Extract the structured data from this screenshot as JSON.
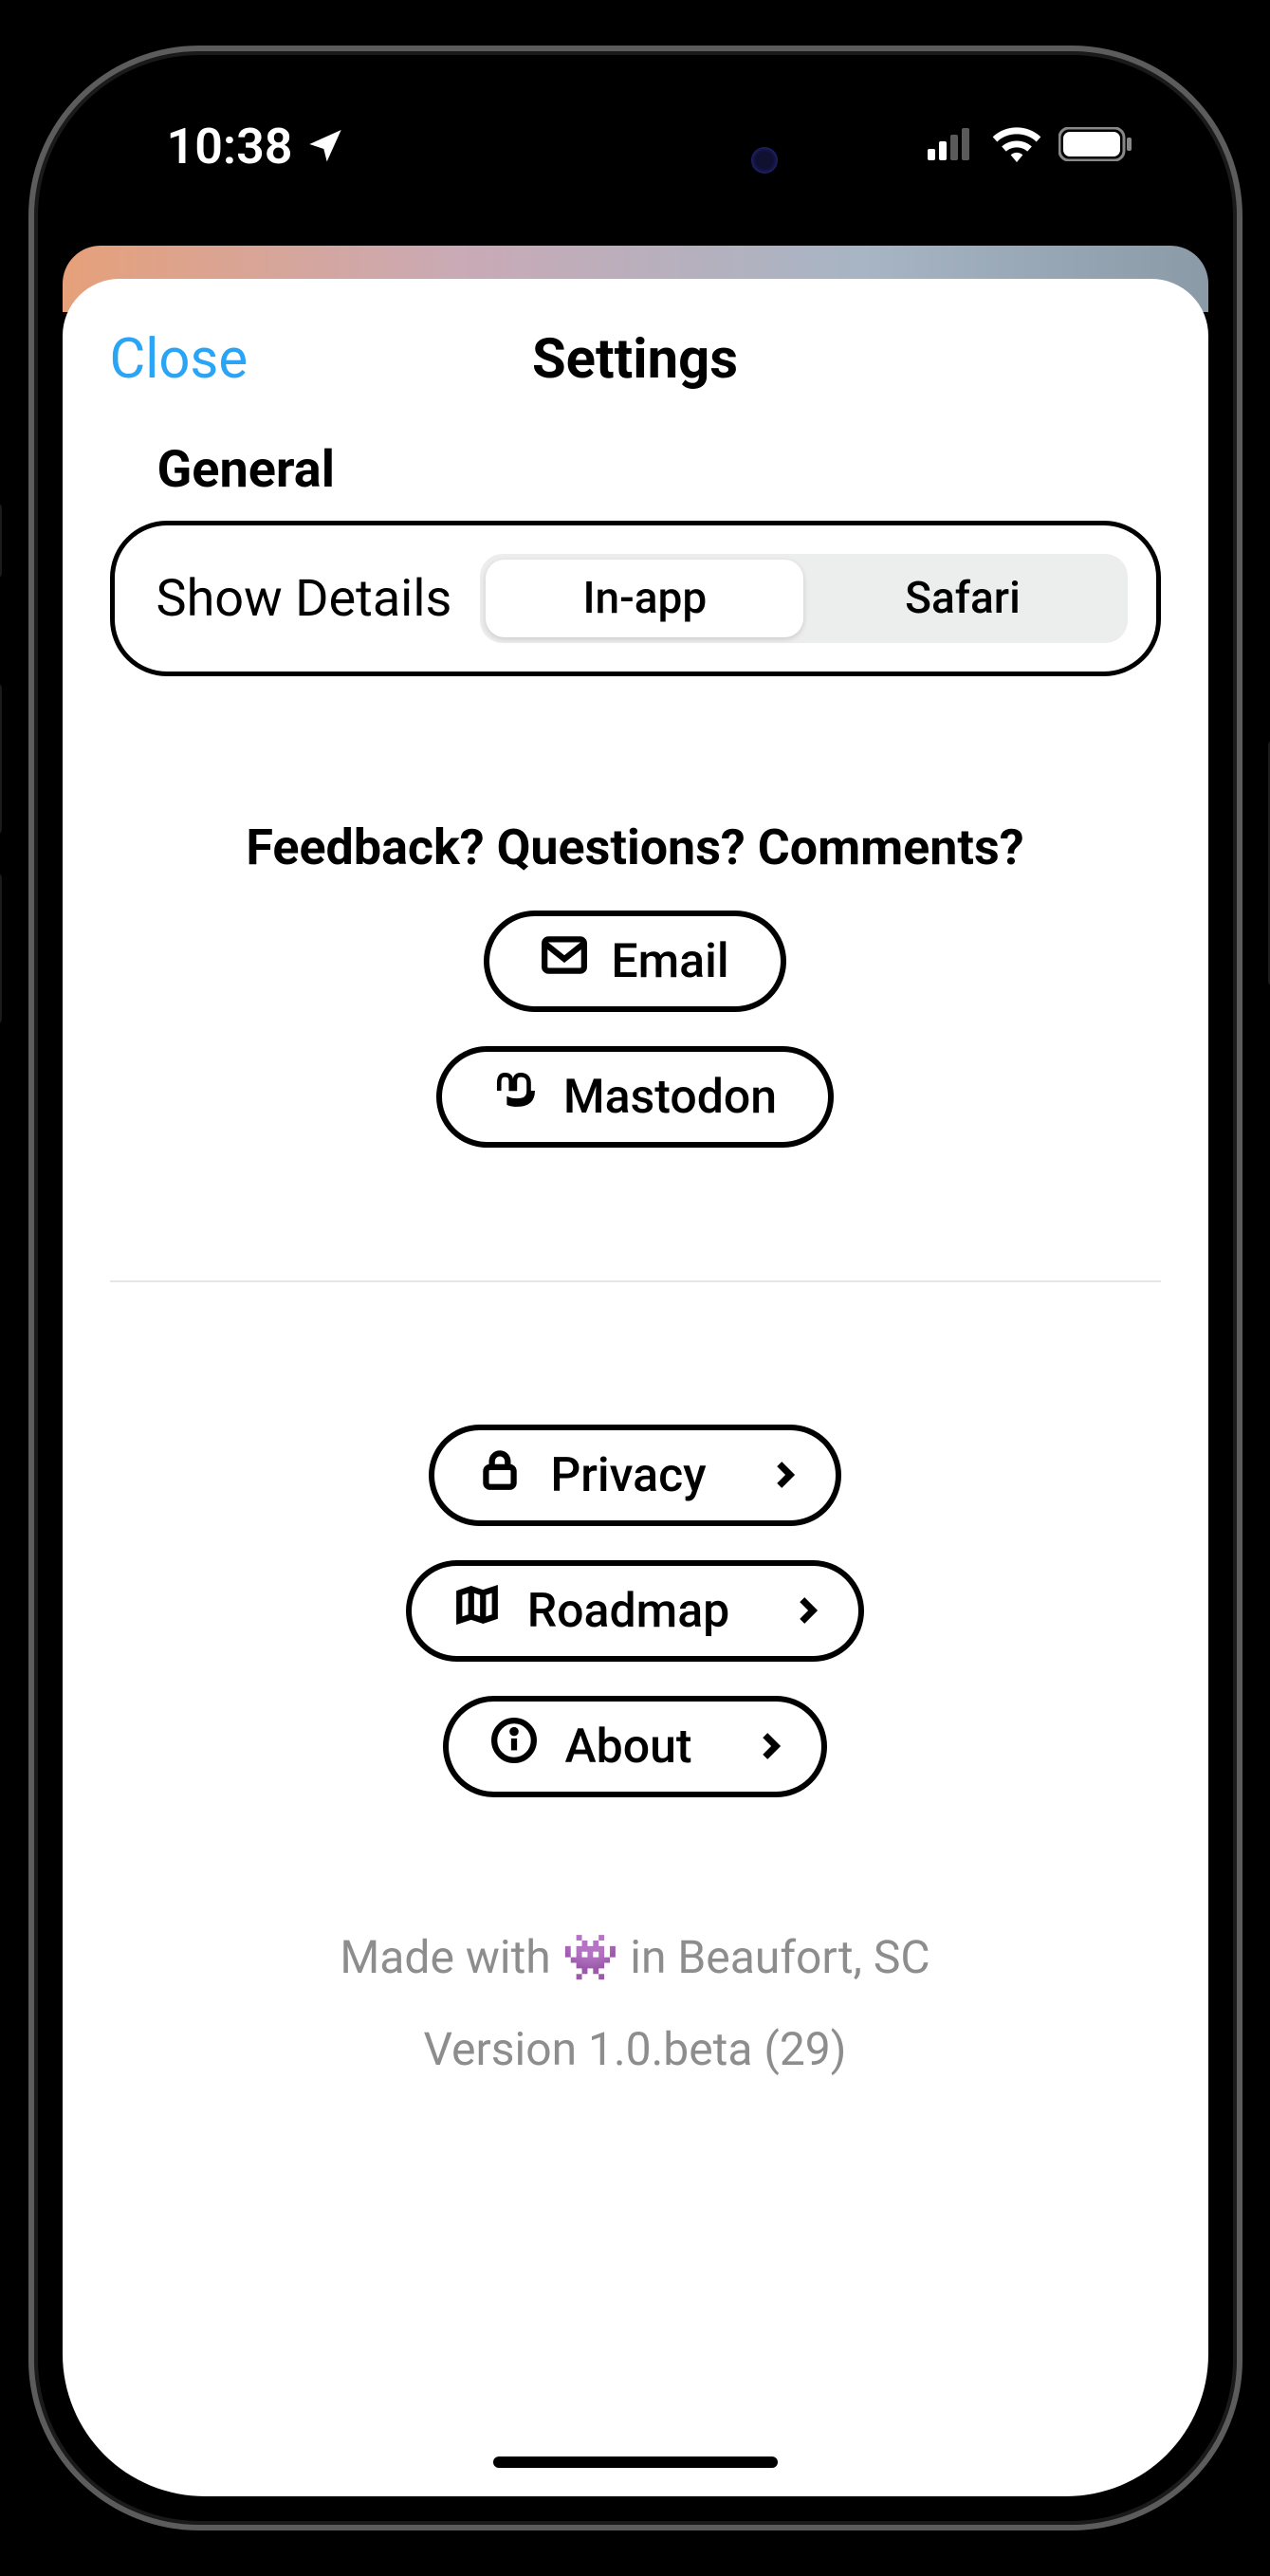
{
  "statusbar": {
    "time": "10:38"
  },
  "sheet": {
    "close_label": "Close",
    "title": "Settings"
  },
  "general": {
    "section_label": "General",
    "row_label": "Show Details",
    "segments": {
      "in_app": "In-app",
      "safari": "Safari",
      "selected": "in_app"
    }
  },
  "feedback": {
    "heading": "Feedback? Questions? Comments?",
    "email_label": "Email",
    "mastodon_label": "Mastodon"
  },
  "nav": {
    "privacy_label": "Privacy",
    "roadmap_label": "Roadmap",
    "about_label": "About"
  },
  "footer": {
    "made_with_prefix": "Made with ",
    "made_with_emoji": "👾",
    "made_with_suffix": " in Beaufort, SC",
    "version": "Version 1.0.beta (29)"
  }
}
